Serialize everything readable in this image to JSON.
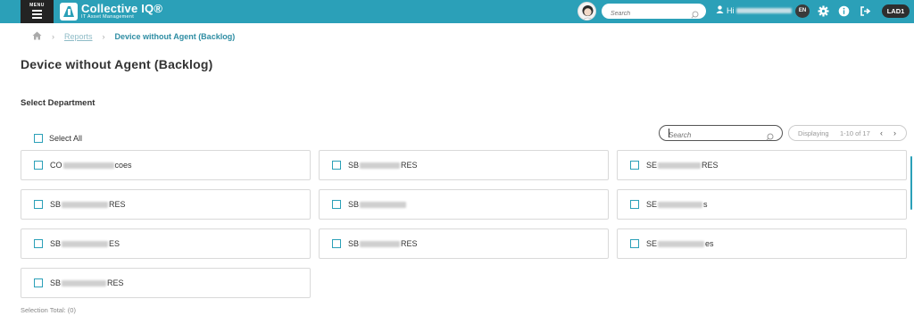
{
  "header": {
    "menu_label": "MENU",
    "logo_title": "Collective IQ®",
    "logo_subtitle": "IT Asset Management",
    "search_placeholder": "Search",
    "user_greeting": "Hi",
    "language": "EN",
    "site_badge": "LAD1",
    "accent_color": "#2ba0b8"
  },
  "breadcrumb": {
    "items": [
      "Reports",
      "Device without Agent (Backlog)"
    ]
  },
  "page": {
    "title": "Device without Agent (Backlog)",
    "section_title": "Select Department",
    "select_all_label": "Select All",
    "search_placeholder": "Search",
    "pager_label": "Displaying",
    "pager_range": "1-10 of 17",
    "selection_total": "Selection Total: (0)"
  },
  "departments": [
    {
      "prefix": "CO",
      "suffix": "coes"
    },
    {
      "prefix": "SB",
      "suffix": "RES"
    },
    {
      "prefix": "SE",
      "suffix": "RES"
    },
    {
      "prefix": "SB",
      "suffix": "RES"
    },
    {
      "prefix": "SB",
      "suffix": ""
    },
    {
      "prefix": "SE",
      "suffix": "s"
    },
    {
      "prefix": "SB",
      "suffix": "ES"
    },
    {
      "prefix": "SB",
      "suffix": "RES"
    },
    {
      "prefix": "SE",
      "suffix": "es"
    },
    {
      "prefix": "SB",
      "suffix": "RES"
    }
  ]
}
